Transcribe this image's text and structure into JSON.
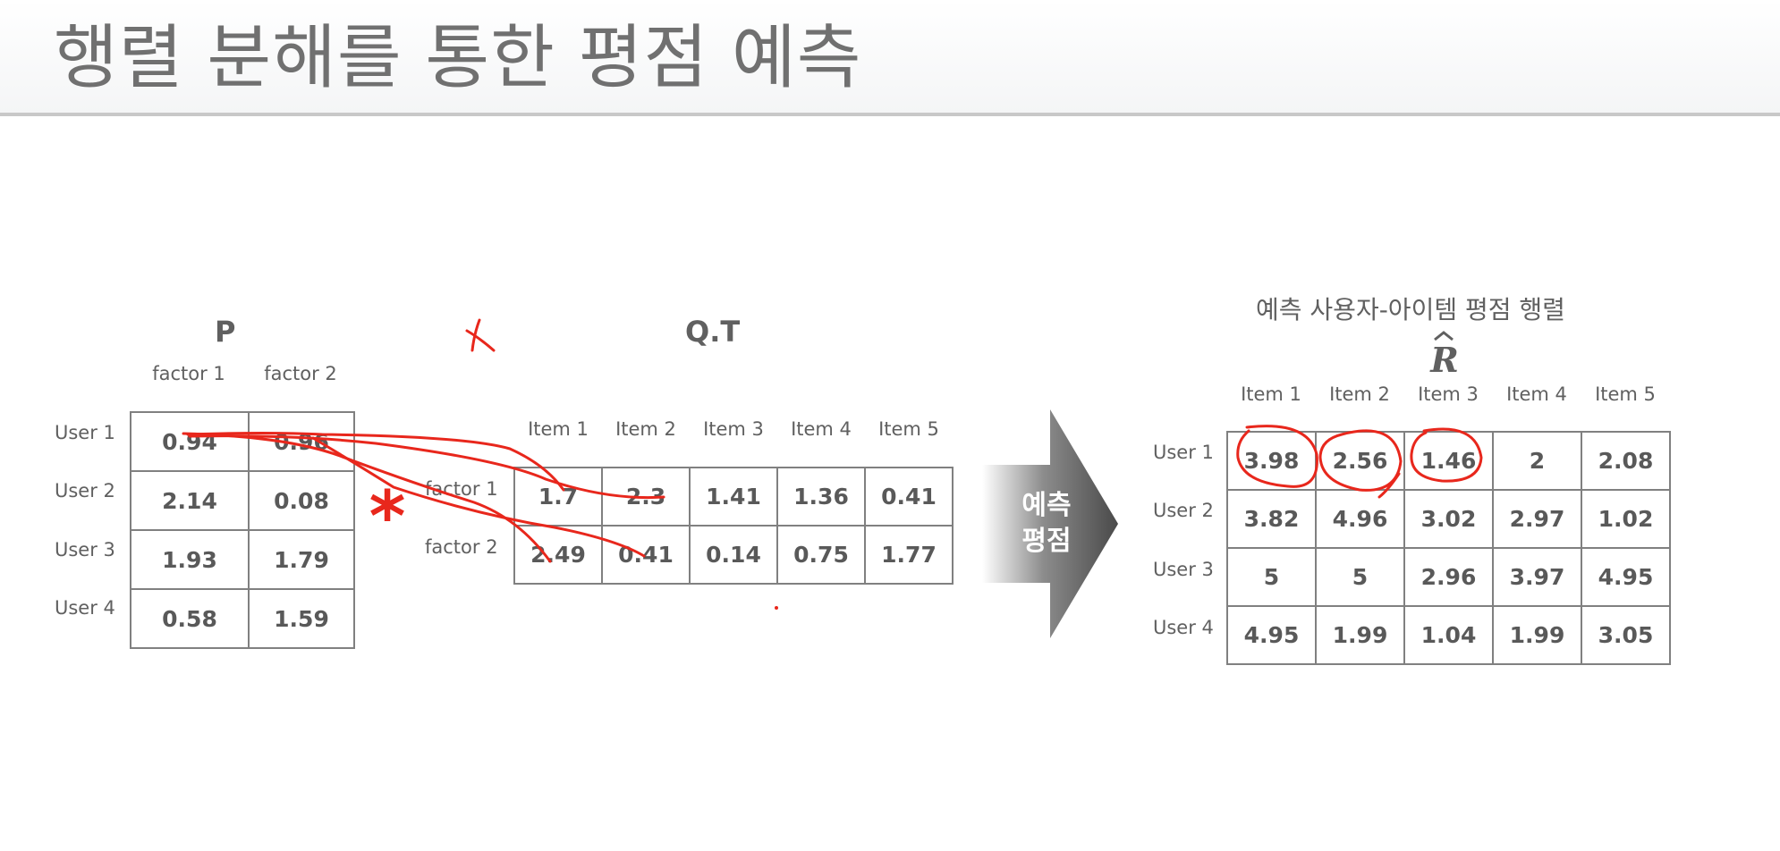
{
  "title": "행렬 분해를 통한 평점 예측",
  "p_matrix": {
    "title": "P",
    "col_headers": [
      "factor 1",
      "factor 2"
    ],
    "row_headers": [
      "User 1",
      "User 2",
      "User 3",
      "User 4"
    ],
    "rows": [
      [
        "0.94",
        "0.96"
      ],
      [
        "2.14",
        "0.08"
      ],
      [
        "1.93",
        "1.79"
      ],
      [
        "0.58",
        "1.59"
      ]
    ]
  },
  "q_matrix": {
    "title": "Q.T",
    "col_headers": [
      "Item 1",
      "Item 2",
      "Item 3",
      "Item 4",
      "Item 5"
    ],
    "row_headers": [
      "factor 1",
      "factor 2"
    ],
    "rows": [
      [
        "1.7",
        "2.3",
        "1.41",
        "1.36",
        "0.41"
      ],
      [
        "2.49",
        "0.41",
        "0.14",
        "0.75",
        "1.77"
      ]
    ]
  },
  "arrow": {
    "line1": "예측",
    "line2": "평점"
  },
  "r_matrix": {
    "title": "예측 사용자-아이템 평점 행렬",
    "symbol": "R",
    "col_headers": [
      "Item 1",
      "Item 2",
      "Item 3",
      "Item 4",
      "Item 5"
    ],
    "row_headers": [
      "User 1",
      "User 2",
      "User 3",
      "User 4"
    ],
    "rows": [
      [
        "3.98",
        "2.56",
        "1.46",
        "2",
        "2.08"
      ],
      [
        "3.82",
        "4.96",
        "3.02",
        "2.97",
        "1.02"
      ],
      [
        "5",
        "5",
        "2.96",
        "3.97",
        "4.95"
      ],
      [
        "4.95",
        "1.99",
        "1.04",
        "1.99",
        "3.05"
      ]
    ]
  },
  "annotation": {
    "operator": "*",
    "ink_color": "#e8271c"
  }
}
